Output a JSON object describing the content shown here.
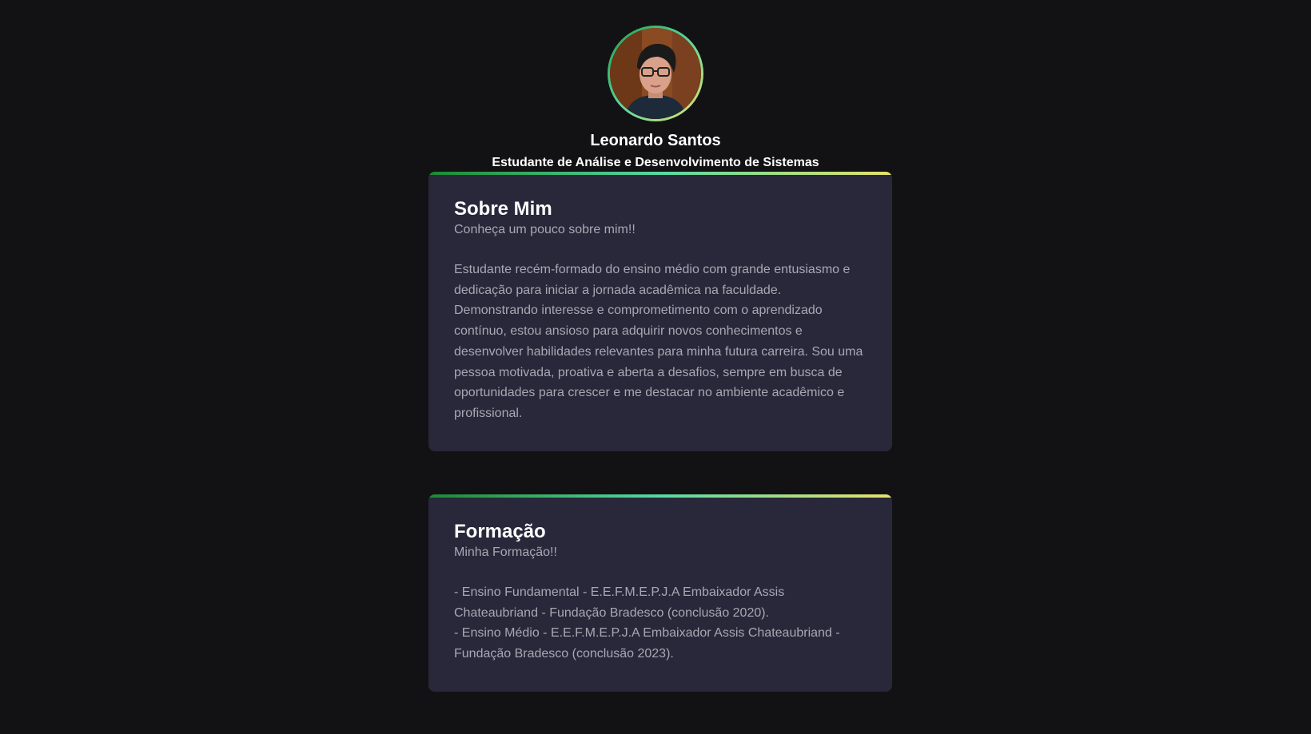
{
  "profile": {
    "name": "Leonardo Santos",
    "role": "Estudante de Análise e Desenvolvimento de Sistemas"
  },
  "about": {
    "title": "Sobre Mim",
    "subtitle": "Conheça um pouco sobre mim!!",
    "text": "Estudante recém-formado do ensino médio com grande entusiasmo e dedicação para iniciar a jornada acadêmica na faculdade. Demonstrando interesse e comprometimento com o aprendizado contínuo, estou ansioso para adquirir novos conhecimentos e desenvolver habilidades relevantes para minha futura carreira. Sou uma pessoa motivada, proativa e aberta a desafios, sempre em busca de oportunidades para crescer e me destacar no ambiente acadêmico e profissional."
  },
  "education": {
    "title": "Formação",
    "subtitle": "Minha Formação!!",
    "items": [
      "- Ensino Fundamental - E.E.F.M.E.P.J.A Embaixador Assis Chateaubriand - Fundação Bradesco (conclusão 2020).",
      "- Ensino Médio - E.E.F.M.E.P.J.A Embaixador Assis Chateaubriand - Fundação Bradesco (conclusão 2023)."
    ]
  },
  "colors": {
    "background": "#121214",
    "card": "#29273a",
    "accent_start": "#1b8a32",
    "accent_mid": "#57d9a3",
    "accent_end": "#e8e36a"
  }
}
